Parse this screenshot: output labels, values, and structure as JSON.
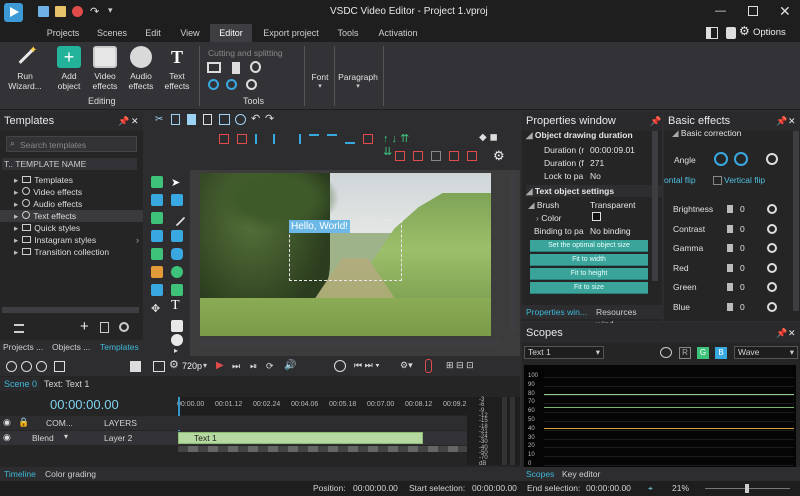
{
  "window": {
    "title": "VSDC Video Editor - Project 1.vproj",
    "options_label": "Options"
  },
  "menu_tabs": [
    "Projects",
    "Scenes",
    "Edit",
    "View",
    "Editor",
    "Export project",
    "Tools",
    "Activation"
  ],
  "ribbon": {
    "run_wizard": "Run Wizard...",
    "add_object": "Add object",
    "video_effects": "Video effects",
    "audio_effects": "Audio effects",
    "text_effects": "Text effects",
    "editing_group": "Editing",
    "cutting": "Cutting and splitting",
    "tools_group": "Tools",
    "font": "Font",
    "paragraph": "Paragraph"
  },
  "templates": {
    "title": "Templates",
    "search_placeholder": "Search templates",
    "header": "TEMPLATE NAME",
    "items": [
      "Templates",
      "Video effects",
      "Audio effects",
      "Text effects",
      "Quick styles",
      "Instagram styles",
      "Transition collection"
    ],
    "bottom_tabs": [
      "Projects ...",
      "Objects ...",
      "Templates"
    ]
  },
  "preview": {
    "overlay_text": "Hello, World!"
  },
  "properties": {
    "title": "Properties window",
    "section1": "Object drawing duration",
    "rows1": [
      [
        "Duration (r",
        "00:00:09.01"
      ],
      [
        "Duration (f",
        "271"
      ],
      [
        "Lock to pa",
        "No"
      ]
    ],
    "section2": "Text object settings",
    "brush_label": "Brush",
    "brush_value": "Transparent",
    "color_label": "Color",
    "binding_label": "Binding to pa",
    "binding_value": "No binding",
    "buttons": [
      "Set the optimal object size",
      "Fit to width",
      "Fit to height",
      "Fit to size"
    ],
    "tabs": [
      "Properties win...",
      "Resources wind..."
    ]
  },
  "effects": {
    "title": "Basic effects",
    "section": "Basic correction",
    "angle": "Angle",
    "horizontal_flip": "ontal flip",
    "vertical_flip": "Vertical flip",
    "rows": [
      [
        "Brightness",
        "0"
      ],
      [
        "Contrast",
        "0"
      ],
      [
        "Gamma",
        "0"
      ],
      [
        "Red",
        "0"
      ],
      [
        "Green",
        "0"
      ],
      [
        "Blue",
        "0"
      ]
    ]
  },
  "scopes": {
    "title": "Scopes",
    "select": "Text 1",
    "channels": [
      "R",
      "G",
      "B"
    ],
    "mode": "Wave",
    "scale": [
      "100",
      "90",
      "80",
      "70",
      "60",
      "50",
      "40",
      "30",
      "20",
      "10",
      "0"
    ],
    "tabs": [
      "Scopes",
      "Key editor"
    ]
  },
  "timeline": {
    "resolution": "720p",
    "scene_tab": "Scene 0",
    "text_tab": "Text: Text 1",
    "time": "00:00:00.00",
    "ticks": [
      "00:00.00",
      "00:01.12",
      "00:02.24",
      "00:04.06",
      "00:05.18",
      "00:07.00",
      "00:08.12",
      "00:09.2"
    ],
    "com_label": "COM...",
    "layers_label": "LAYERS",
    "blend_label": "Blend",
    "layer_label": "Layer 2",
    "clip_label": "Text 1",
    "db_scale": [
      "-3",
      "-6",
      "-9",
      "-12",
      "-15",
      "-18",
      "-21",
      "-24",
      "-30",
      "-40",
      "-50",
      "-70",
      "dB"
    ],
    "bottom_tabs": [
      "Timeline",
      "Color grading"
    ]
  },
  "status": {
    "position_label": "Position:",
    "position": "00:00:00.00",
    "start_label": "Start selection:",
    "start": "00:00:00.00",
    "end_label": "End selection:",
    "end": "00:00:00.00",
    "zoom": "21%"
  }
}
